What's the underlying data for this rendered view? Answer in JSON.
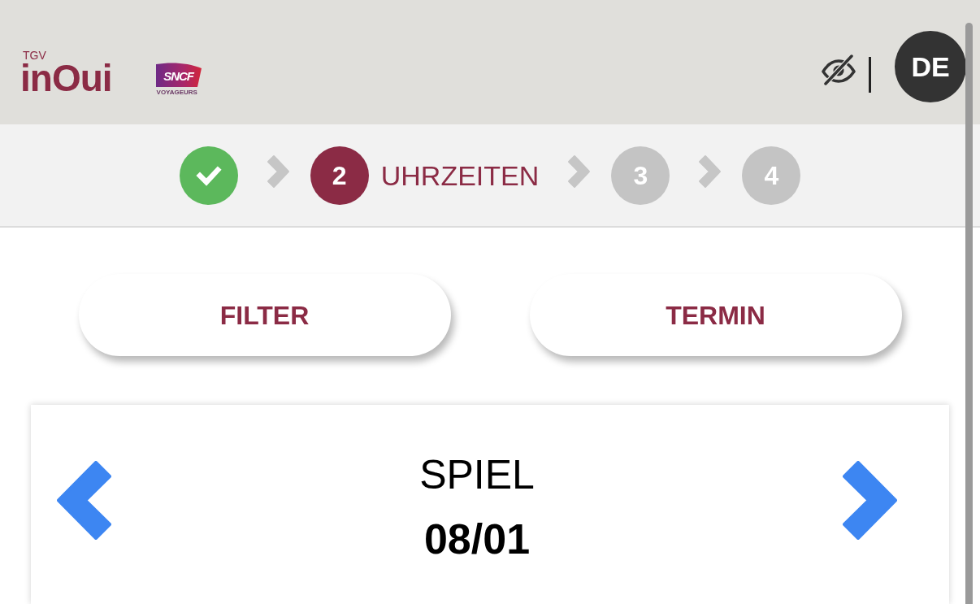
{
  "header": {
    "logo": {
      "tagline": "TGV",
      "wordmark": "inOui"
    },
    "partner_logo": {
      "wordmark": "SNCF",
      "caption": "VOYAGEURS"
    },
    "language": "DE"
  },
  "stepper": {
    "steps": [
      {
        "kind": "done"
      },
      {
        "number": "2",
        "label": "UHRZEITEN",
        "kind": "current"
      },
      {
        "number": "3",
        "kind": "upcoming"
      },
      {
        "number": "4",
        "kind": "upcoming"
      }
    ]
  },
  "actions": [
    {
      "label": "FILTER"
    },
    {
      "label": "TERMIN"
    }
  ],
  "match_card": {
    "title": "SPIEL",
    "date": "08/01"
  }
}
